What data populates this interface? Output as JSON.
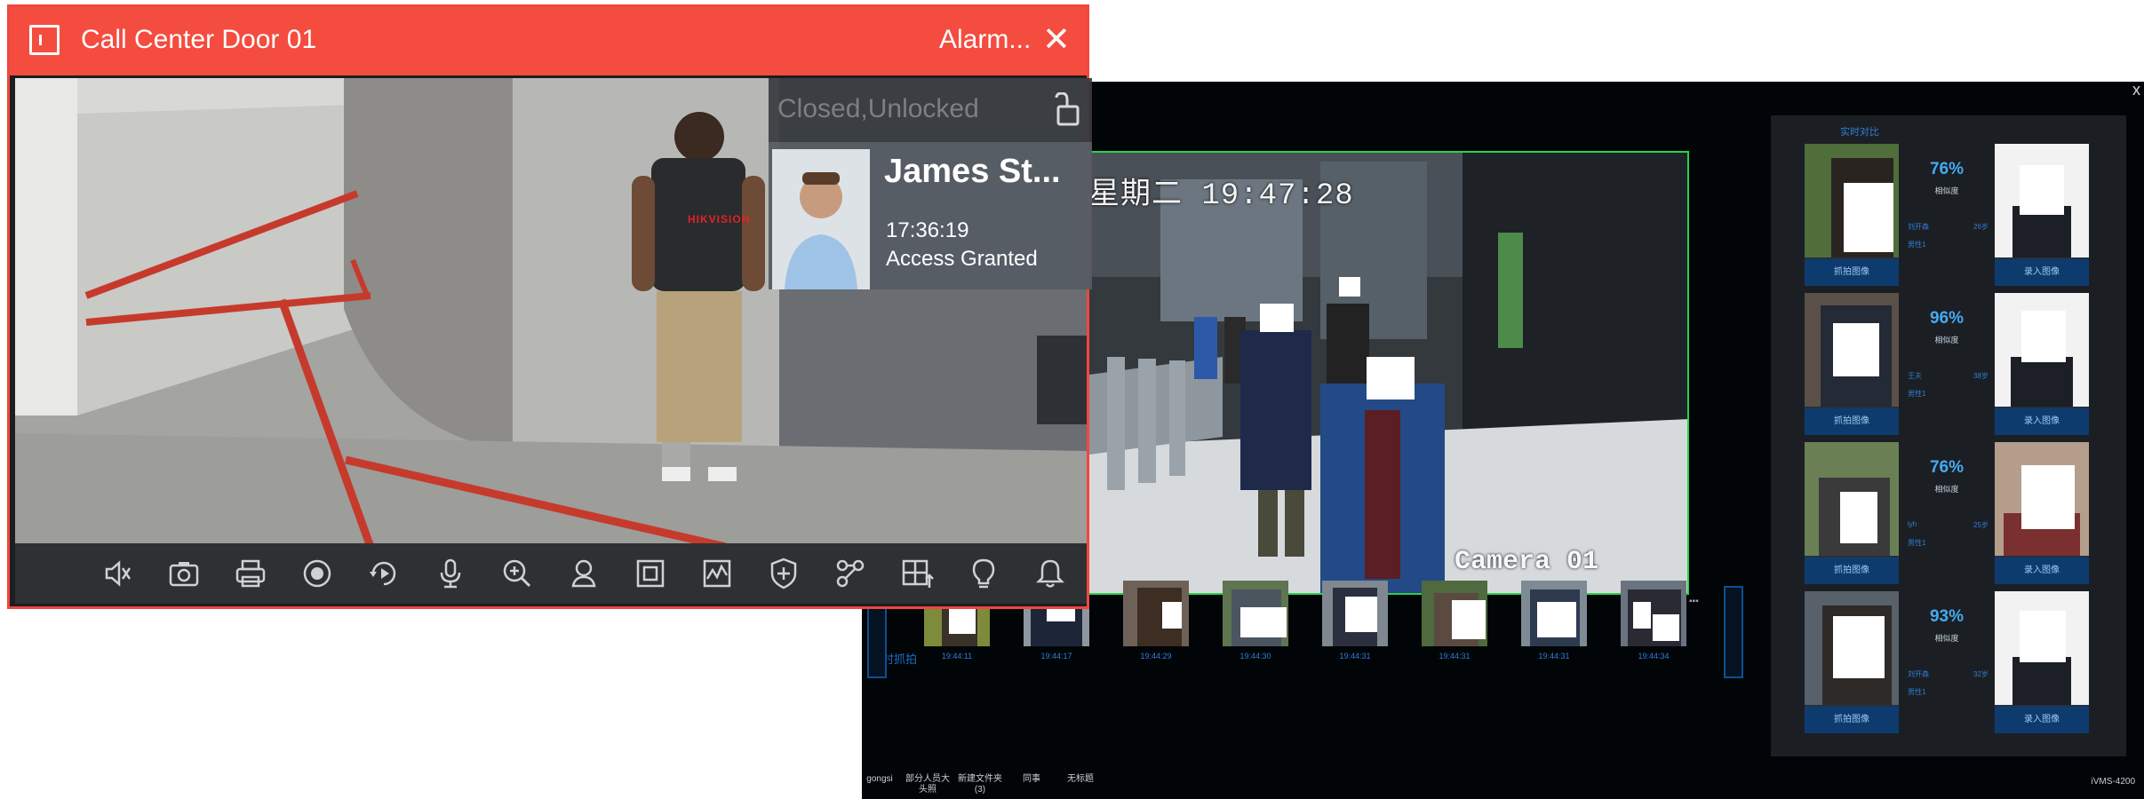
{
  "alarm_popup": {
    "title": "Call Center Door 01",
    "alarm_label": "Alarm...",
    "close_glyph": "✕",
    "door_status": "Closed,Unlocked",
    "event": {
      "person_name": "James St...",
      "time": "17:36:19",
      "result": "Access Granted"
    },
    "jersey_text": "HIKVISION",
    "toolbar_icons": [
      "mute-icon",
      "snapshot-icon",
      "print-icon",
      "record-icon",
      "playback-icon",
      "microphone-icon",
      "zoom-in-icon",
      "face-icon",
      "fullscreen-icon",
      "graph-icon",
      "shield-icon",
      "linkage-icon",
      "layout-icon",
      "light-icon",
      "bell-icon"
    ],
    "accent_color": "#f44c3f"
  },
  "ivms": {
    "close_glyph": "x",
    "video": {
      "osd_text": "星期二 19:47:28",
      "camera_label": "Camera 01"
    },
    "capture_strip": {
      "label": "实时抓拍",
      "times": [
        "19:44:11",
        "19:44:17",
        "19:44:29",
        "19:44:30",
        "19:44:31",
        "19:44:31",
        "19:44:31",
        "19:44:34"
      ]
    },
    "folders": [
      "gongsi",
      "部分人员大头照",
      "新建文件夹 (3)",
      "同事",
      "无标题"
    ],
    "compare": {
      "title": "实时对比",
      "snapshot_button": "抓拍图像",
      "enrolled_button": "录入图像",
      "similarity_label": "相似度",
      "rows": [
        {
          "percent": "76%",
          "name": "刘开森",
          "age": "26岁",
          "gender": "男性1"
        },
        {
          "percent": "96%",
          "name": "王夫",
          "age": "38岁",
          "gender": "男性1"
        },
        {
          "percent": "76%",
          "name": "lyh",
          "age": "25岁",
          "gender": "男性1"
        },
        {
          "percent": "93%",
          "name": "刘开森",
          "age": "32岁",
          "gender": "男性1"
        }
      ]
    },
    "brand": "iVMS-4200",
    "accent_color": "#2e7fd5"
  }
}
